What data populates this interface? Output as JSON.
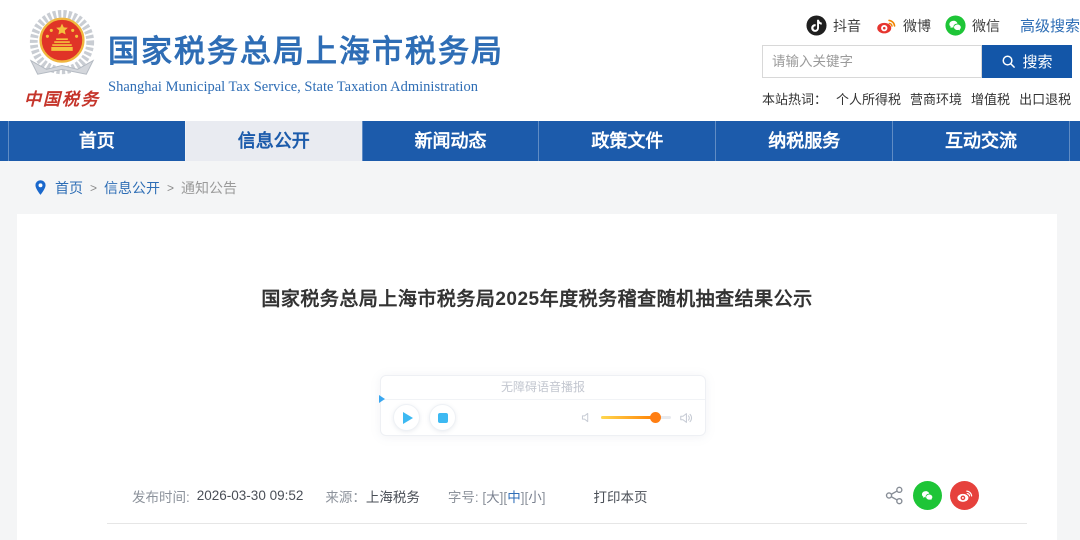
{
  "header": {
    "site_title": "国家税务总局上海市税务局",
    "site_subtitle": "Shanghai Municipal Tax Service, State Taxation Administration",
    "logo_caption": "中国税务",
    "social": [
      {
        "icon": "douyin-icon",
        "label": "抖音"
      },
      {
        "icon": "weibo-icon",
        "label": "微博"
      },
      {
        "icon": "wechat-icon",
        "label": "微信"
      }
    ],
    "advanced_search_label": "高级搜索",
    "search": {
      "placeholder": "请输入关键字",
      "button_label": "搜索",
      "button_icon": "search-icon"
    },
    "hot_words": {
      "label": "本站热词：",
      "words": [
        "个人所得税",
        "营商环境",
        "增值税",
        "出口退税"
      ]
    }
  },
  "nav": {
    "items": [
      {
        "label": "首页",
        "active": false
      },
      {
        "label": "信息公开",
        "active": true
      },
      {
        "label": "新闻动态",
        "active": false
      },
      {
        "label": "政策文件",
        "active": false
      },
      {
        "label": "纳税服务",
        "active": false
      },
      {
        "label": "互动交流",
        "active": false
      }
    ]
  },
  "breadcrumb": {
    "icon": "location-pin-icon",
    "separator": ">",
    "items": [
      "首页",
      "信息公开",
      "通知公告"
    ]
  },
  "article": {
    "title": "国家税务总局上海市税务局2025年度税务稽查随机抽查结果公示",
    "player": {
      "title": "无障碍语音播报",
      "icons": [
        "play-icon",
        "stop-icon",
        "volume-low-icon",
        "volume-high-icon"
      ],
      "volume_percent": 77
    },
    "meta": {
      "publish_label": "发布时间:",
      "publish_time": "2026-03-30 09:52",
      "source_label": "来源：",
      "source": "上海税务",
      "font_size_label": "字号:",
      "bracket_open": "[",
      "bracket_close": "]",
      "font_sizes": [
        "大",
        "中",
        "小"
      ],
      "font_size_active": "中",
      "print_label": "打印本页",
      "share_icons": [
        "share-nodes-icon",
        "wechat-icon",
        "weibo-icon"
      ]
    }
  },
  "colors": {
    "nav_blue": "#1c5bab",
    "title_blue": "#2e6db5",
    "search_button_blue": "#1356a8",
    "active_fontsize_blue": "#2f6eb8",
    "wechat_green": "#1ec537",
    "weibo_red": "#e6413c",
    "douyin_black": "#1f1f1f",
    "player_blue": "#3db9f2",
    "volume_orange": "#ff7e12",
    "logo_red": "#e03427",
    "logo_gold": "#f0b63e"
  }
}
